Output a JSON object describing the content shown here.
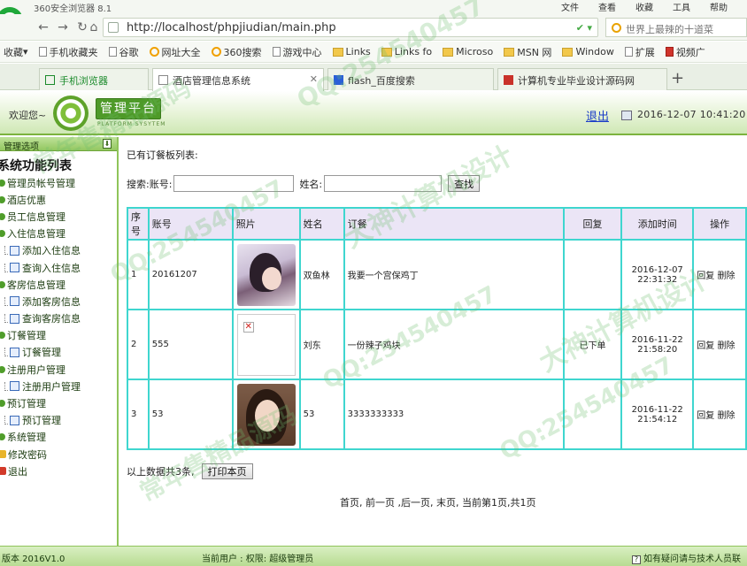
{
  "browser": {
    "title": "360安全浏览器 8.1",
    "menus": [
      "文件",
      "查看",
      "收藏",
      "工具",
      "帮助"
    ],
    "url": "http://localhost/phpjiudian/main.php",
    "search_placeholder": "世界上最辣的十道菜",
    "bookmarks": [
      "收藏",
      "手机收藏夹",
      "谷歌",
      "网址大全",
      "360搜索",
      "游戏中心",
      "Links",
      "Links fo",
      "Microso",
      "MSN 网",
      "Window",
      "扩展",
      "视频广"
    ],
    "tabs": [
      "手机浏览器",
      "酒店管理信息系统",
      "flash_百度搜索",
      "计算机专业毕业设计源码网"
    ]
  },
  "header": {
    "welcome": "欢迎您~",
    "logo_title": "管理平台",
    "logo_sub": "PLATFORM SYSYTEM",
    "logout": "退出",
    "datetime": "2016-12-07 10:41:20"
  },
  "sidebar": {
    "head": "管理选项",
    "title": "系统功能列表",
    "items": [
      {
        "label": "管理员帐号管理",
        "level": 0
      },
      {
        "label": "酒店优惠",
        "level": 0
      },
      {
        "label": "员工信息管理",
        "level": 0
      },
      {
        "label": "入住信息管理",
        "level": 0
      },
      {
        "label": "添加入住信息",
        "level": 1
      },
      {
        "label": "查询入住信息",
        "level": 1
      },
      {
        "label": "客房信息管理",
        "level": 0
      },
      {
        "label": "添加客房信息",
        "level": 1
      },
      {
        "label": "查询客房信息",
        "level": 1
      },
      {
        "label": "订餐管理",
        "level": 0
      },
      {
        "label": "订餐管理",
        "level": 1
      },
      {
        "label": "注册用户管理",
        "level": 0
      },
      {
        "label": "注册用户管理",
        "level": 1
      },
      {
        "label": "预订管理",
        "level": 0
      },
      {
        "label": "预订管理",
        "level": 1
      },
      {
        "label": "系统管理",
        "level": 0
      },
      {
        "label": "修改密码",
        "level": 0
      },
      {
        "label": "退出",
        "level": 0
      }
    ]
  },
  "content": {
    "list_title": "已有订餐板列表:",
    "search_label": "搜索:",
    "account_label": "账号:",
    "account_value": "",
    "name_label": "姓名:",
    "name_value": "",
    "search_button": "查找",
    "columns": [
      "序号",
      "账号",
      "照片",
      "姓名",
      "订餐",
      "回复",
      "添加时间",
      "操作"
    ],
    "rows": [
      {
        "no": "1",
        "account": "20161207",
        "photo": "photo-1",
        "name": "双鱼林",
        "order": "我要一个宫保鸡丁",
        "reply": "",
        "date": "2016-12-07",
        "time": "22:31:32",
        "reply_action": "回复",
        "delete_action": "删除"
      },
      {
        "no": "2",
        "account": "555",
        "photo": "broken",
        "name": "刘东",
        "order": "一份辣子鸡块",
        "reply": "已下单",
        "date": "2016-11-22",
        "time": "21:58:20",
        "reply_action": "回复",
        "delete_action": "删除"
      },
      {
        "no": "3",
        "account": "53",
        "photo": "photo-3",
        "name": "53",
        "order": "3333333333",
        "reply": "",
        "date": "2016-11-22",
        "time": "21:54:12",
        "reply_action": "回复",
        "delete_action": "删除"
      }
    ],
    "total_text": "以上数据共3条,",
    "print_button": "打印本页",
    "pager": "首页, 前一页 ,后一页, 末页, 当前第1页,共1页"
  },
  "footer": {
    "version": "版本 2016V1.0",
    "current_user": "当前用户 : 权限:  超级管理员",
    "help": "如有疑问请与技术人员联"
  },
  "watermarks": [
    "QQ:254540457",
    "大神计算机设计",
    "常年售精品源码"
  ]
}
